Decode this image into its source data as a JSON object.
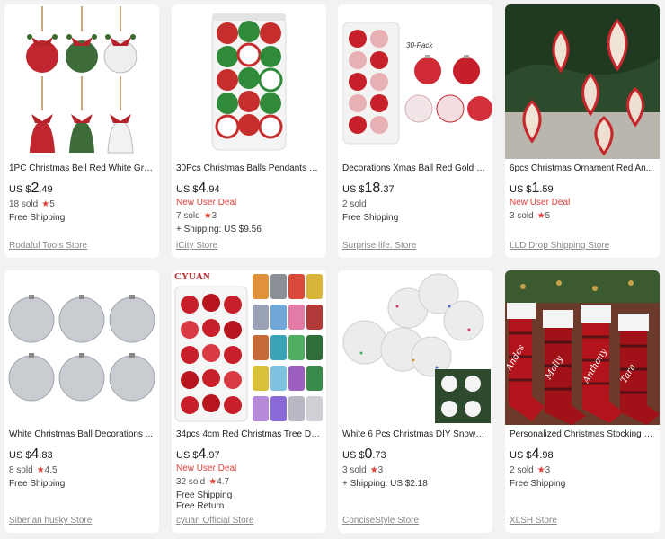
{
  "products": [
    {
      "title": "1PC Christmas Bell Red White Gre...",
      "currency": "US $",
      "price_int": "2",
      "price_dec": ".49",
      "deal": "",
      "sold": "18 sold",
      "rating": "5",
      "shipping": [
        "Free Shipping"
      ],
      "store": "Rodaful Tools Store",
      "image": "bells-icon"
    },
    {
      "title": "30Pcs Christmas Balls Pendants El...",
      "currency": "US $",
      "price_int": "4",
      "price_dec": ".94",
      "deal": "New User Deal",
      "sold": "7 sold",
      "rating": "3",
      "shipping": [
        "+ Shipping: US $9.56"
      ],
      "store": "iCity Store",
      "image": "red-green-balls-tube-icon"
    },
    {
      "title": "Decorations Xmas Ball Red Gold Si...",
      "currency": "US $",
      "price_int": "18",
      "price_dec": ".37",
      "deal": "",
      "sold": "2 sold",
      "rating": "",
      "shipping": [
        "Free Shipping"
      ],
      "store": "Surprise life. Store",
      "image": "red-balls-30pack-icon",
      "badge": "30-Pack"
    },
    {
      "title": "6pcs Christmas Ornament Red An...",
      "currency": "US $",
      "price_int": "1",
      "price_dec": ".59",
      "deal": "New User Deal",
      "sold": "3 sold",
      "rating": "5",
      "shipping": [],
      "store": "LLD Drop Shipping Store",
      "image": "onion-ornaments-icon"
    },
    {
      "title": "White Christmas Ball Decorations ...",
      "currency": "US $",
      "price_int": "4",
      "price_dec": ".83",
      "deal": "",
      "sold": "8 sold",
      "rating": "4.5",
      "shipping": [
        "Free Shipping"
      ],
      "store": "Siberian husky Store",
      "image": "silver-balls-icon"
    },
    {
      "title": "34pcs 4cm Red Christmas Tree De...",
      "currency": "US $",
      "price_int": "4",
      "price_dec": ".97",
      "deal": "New User Deal",
      "sold": "32 sold",
      "rating": "4.7",
      "shipping": [
        "Free Shipping",
        "Free Return"
      ],
      "store": "cyuan Official Store",
      "image": "cyuan-balls-icon",
      "badge": "CYUAN"
    },
    {
      "title": "White 6 Pcs Christmas DIY Snowba...",
      "currency": "US $",
      "price_int": "0",
      "price_dec": ".73",
      "deal": "",
      "sold": "3 sold",
      "rating": "3",
      "shipping": [
        "+ Shipping: US $2.18"
      ],
      "store": "ConciseStyle Store",
      "image": "white-snowballs-icon"
    },
    {
      "title": "Personalized Christmas Stocking H...",
      "currency": "US $",
      "price_int": "4",
      "price_dec": ".98",
      "deal": "",
      "sold": "2 sold",
      "rating": "3",
      "shipping": [
        "Free Shipping"
      ],
      "store": "XLSH Store",
      "image": "plaid-stockings-icon",
      "stocking_names": [
        "Andes",
        "Molly",
        "Anthony",
        "Tara"
      ]
    }
  ],
  "colors": {
    "accent_red": "#e0413a",
    "text": "#191919",
    "muted": "#888888",
    "background": "#f2f2f2"
  }
}
